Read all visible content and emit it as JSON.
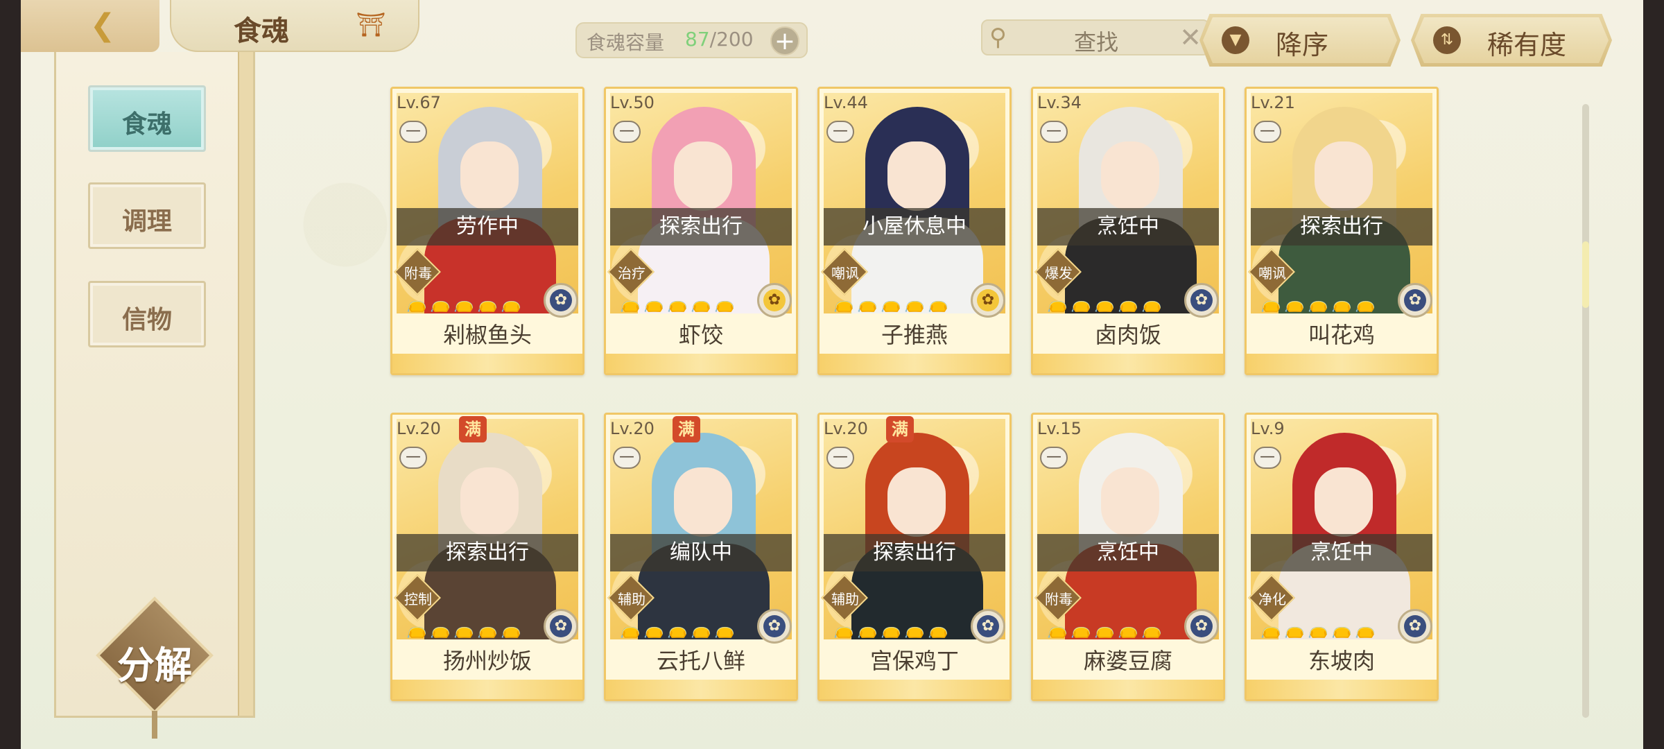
{
  "header": {
    "title": "食魂",
    "capacity_label": "食魂容量",
    "capacity_current": "87",
    "capacity_max": "/200",
    "search_placeholder": "查找",
    "sort_label": "降序",
    "rarity_label": "稀有度"
  },
  "sidebar": {
    "items": [
      {
        "label": "食魂",
        "active": true
      },
      {
        "label": "调理",
        "active": false
      },
      {
        "label": "信物",
        "active": false
      }
    ],
    "decompose_label": "分解"
  },
  "cards": [
    {
      "level": "Lv.67",
      "full": "",
      "status": "劳作中",
      "tag": "附毒",
      "name": "剁椒鱼头",
      "stars": 4,
      "elem": "water",
      "palette": [
        "#c9ced6",
        "#c8322a"
      ]
    },
    {
      "level": "Lv.50",
      "full": "",
      "status": "探索出行",
      "tag": "治疗",
      "name": "虾饺",
      "stars": 3,
      "elem": "fire",
      "palette": [
        "#f2a0b4",
        "#f6f0f4"
      ]
    },
    {
      "level": "Lv.44",
      "full": "",
      "status": "小屋休息中",
      "tag": "嘲讽",
      "name": "子推燕",
      "stars": 3,
      "elem": "fire",
      "palette": [
        "#2a2f55",
        "#f2f2f0"
      ]
    },
    {
      "level": "Lv.34",
      "full": "",
      "status": "烹饪中",
      "tag": "爆发",
      "name": "卤肉饭",
      "stars": 2,
      "elem": "water",
      "palette": [
        "#e9e6df",
        "#2b2a2a"
      ]
    },
    {
      "level": "Lv.21",
      "full": "",
      "status": "探索出行",
      "tag": "嘲讽",
      "name": "叫花鸡",
      "stars": 2,
      "elem": "water",
      "palette": [
        "#f1d58c",
        "#3e5b3e"
      ]
    },
    {
      "level": "Lv.20",
      "full": "满",
      "status": "探索出行",
      "tag": "控制",
      "name": "扬州炒饭",
      "stars": 1,
      "elem": "water",
      "palette": [
        "#e8dcc6",
        "#5a4434"
      ]
    },
    {
      "level": "Lv.20",
      "full": "满",
      "status": "编队中",
      "tag": "辅助",
      "name": "云托八鲜",
      "stars": 1,
      "elem": "water",
      "palette": [
        "#8ec3d8",
        "#2d3440"
      ]
    },
    {
      "level": "Lv.20",
      "full": "满",
      "status": "探索出行",
      "tag": "辅助",
      "name": "宫保鸡丁",
      "stars": 1,
      "elem": "water",
      "palette": [
        "#c8451f",
        "#222a2e"
      ]
    },
    {
      "level": "Lv.15",
      "full": "",
      "status": "烹饪中",
      "tag": "附毒",
      "name": "麻婆豆腐",
      "stars": 1,
      "elem": "water",
      "palette": [
        "#f2f0ea",
        "#c83a24"
      ]
    },
    {
      "level": "Lv.9",
      "full": "",
      "status": "烹饪中",
      "tag": "净化",
      "name": "东坡肉",
      "stars": 1,
      "elem": "water",
      "palette": [
        "#c02a2a",
        "#f1e8de"
      ]
    }
  ]
}
